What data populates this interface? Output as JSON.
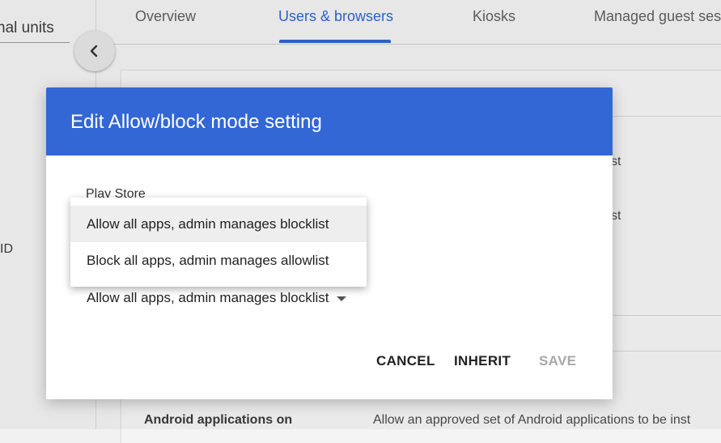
{
  "sidebar": {
    "org_unit_fragment": "nal units",
    "id_fragment": "ID"
  },
  "tabs": [
    {
      "label": "Overview"
    },
    {
      "label": "Users & browsers",
      "active": true
    },
    {
      "label": "Kiosks"
    },
    {
      "label": "Managed guest ses"
    }
  ],
  "background": {
    "fragment_1": "st",
    "fragment_2": "st",
    "setting_name": "Android applications on",
    "setting_description": "Allow an approved set of Android applications to be inst"
  },
  "dialog": {
    "title": "Edit Allow/block mode setting",
    "field_label": "Play Store",
    "selected_value": "Allow all apps, admin manages blocklist",
    "cancel_label": "CANCEL",
    "inherit_label": "INHERIT",
    "save_label": "SAVE"
  },
  "menu": {
    "options": [
      {
        "label": "Allow all apps, admin manages blocklist",
        "selected": true
      },
      {
        "label": "Block all apps, admin manages allowlist",
        "selected": false
      }
    ]
  },
  "colors": {
    "accent": "#3367d6",
    "tab_active": "#2f64d2"
  },
  "icons": {
    "collapse": "chevron-left-icon",
    "select_arrow": "arrow-drop-down-icon"
  }
}
